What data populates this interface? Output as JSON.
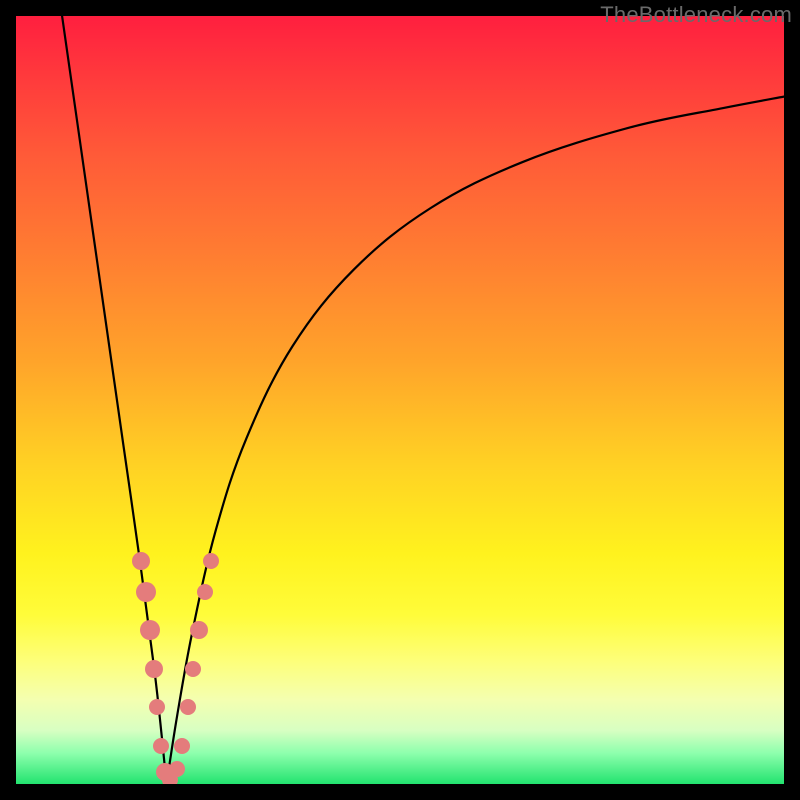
{
  "watermark": "TheBottleneck.com",
  "chart_data": {
    "type": "line",
    "title": "",
    "xlabel": "",
    "ylabel": "",
    "xlim": [
      0,
      100
    ],
    "ylim": [
      0,
      100
    ],
    "grid": false,
    "legend": false,
    "series": [
      {
        "name": "left-branch",
        "x": [
          6,
          8,
          10,
          12,
          14,
          16,
          18,
          19,
          19.6
        ],
        "values": [
          100,
          86,
          72,
          58,
          44,
          30,
          15,
          6,
          0
        ]
      },
      {
        "name": "right-branch",
        "x": [
          19.6,
          21,
          23,
          26,
          30,
          36,
          44,
          54,
          66,
          80,
          92,
          100
        ],
        "values": [
          0,
          9,
          20,
          33,
          45,
          57,
          67,
          75,
          81,
          85.5,
          88,
          89.5
        ]
      }
    ],
    "dots": {
      "name": "highlight-markers",
      "points": [
        {
          "x": 16.3,
          "y": 29,
          "r": 9
        },
        {
          "x": 16.9,
          "y": 25,
          "r": 10
        },
        {
          "x": 17.5,
          "y": 20,
          "r": 10
        },
        {
          "x": 18.0,
          "y": 15,
          "r": 9
        },
        {
          "x": 18.4,
          "y": 10,
          "r": 8
        },
        {
          "x": 18.9,
          "y": 5,
          "r": 8
        },
        {
          "x": 19.4,
          "y": 1.5,
          "r": 9
        },
        {
          "x": 20.1,
          "y": 0.5,
          "r": 8
        },
        {
          "x": 20.9,
          "y": 2,
          "r": 8
        },
        {
          "x": 21.6,
          "y": 5,
          "r": 8
        },
        {
          "x": 22.4,
          "y": 10,
          "r": 8
        },
        {
          "x": 23.1,
          "y": 15,
          "r": 8
        },
        {
          "x": 23.8,
          "y": 20,
          "r": 9
        },
        {
          "x": 24.6,
          "y": 25,
          "r": 8
        },
        {
          "x": 25.4,
          "y": 29,
          "r": 8
        }
      ]
    }
  }
}
